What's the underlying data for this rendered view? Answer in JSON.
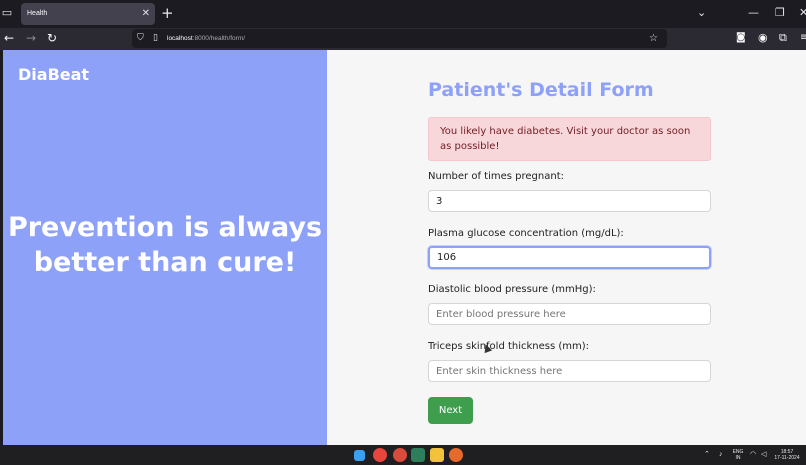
{
  "browser": {
    "tab_title": "Health",
    "tab_close": "✕",
    "new_tab": "+",
    "url_host": "localhost",
    "url_path": ":8000/health/form/",
    "icons": [
      "tab-list-icon",
      "back-icon",
      "forward-icon",
      "reload-icon",
      "shield-icon",
      "page-icon",
      "star-icon",
      "pocket-icon",
      "account-icon",
      "extensions-icon",
      "menu-icon"
    ]
  },
  "left": {
    "brand": "DiaBeat",
    "tagline": "Prevention is always better than cure!"
  },
  "form": {
    "title": "Patient's Detail Form",
    "alert": "You likely have diabetes. Visit your doctor as soon as possible!",
    "fields": [
      {
        "label": "Number of times pregnant:",
        "value": "3",
        "placeholder": ""
      },
      {
        "label": "Plasma glucose concentration (mg/dL):",
        "value": "106",
        "placeholder": ""
      },
      {
        "label": "Diastolic blood pressure (mmHg):",
        "value": "",
        "placeholder": "Enter blood pressure here"
      },
      {
        "label": "Triceps skinfold thickness (mm):",
        "value": "",
        "placeholder": "Enter skin thickness here"
      }
    ],
    "next_label": "Next"
  },
  "taskbar": {
    "lang_line1": "ENG",
    "lang_line2": "IN",
    "time": "18:57",
    "date": "17-11-2024"
  },
  "colors": {
    "accent": "#8ea1f8",
    "alert_bg": "#f8d7da",
    "alert_text": "#721c24",
    "button": "#3f9e4d"
  }
}
